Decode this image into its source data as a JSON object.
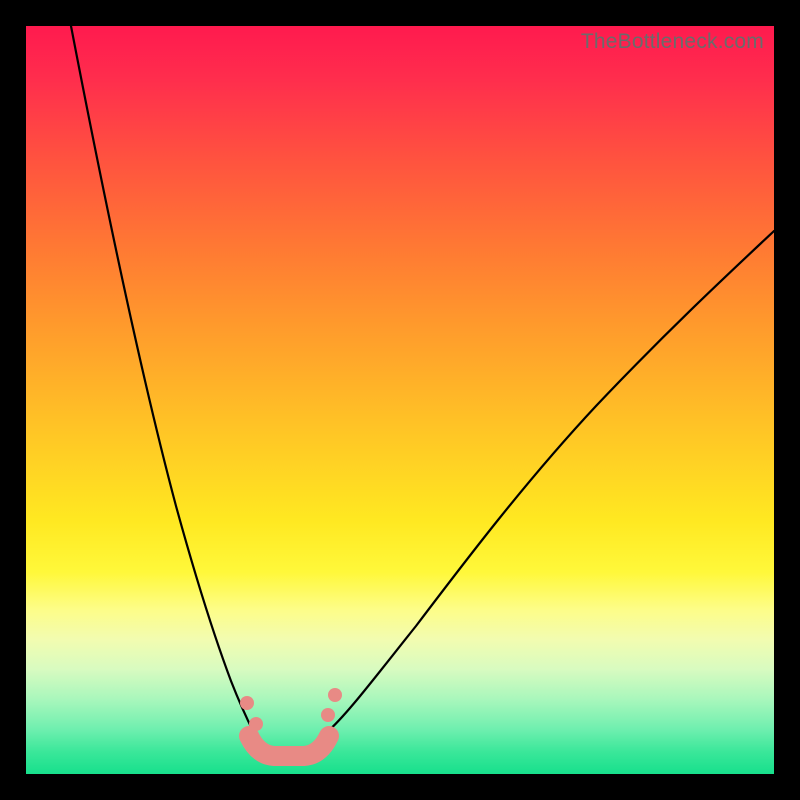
{
  "watermark": "TheBottleneck.com",
  "colors": {
    "bg_black": "#000000",
    "marker": "#e88a85",
    "line": "#000000",
    "gradient_top": "#ff1a4e",
    "gradient_bottom": "#17e08c"
  },
  "chart_data": {
    "type": "line",
    "title": "",
    "xlabel": "",
    "ylabel": "",
    "xlim": [
      0,
      100
    ],
    "ylim": [
      0,
      100
    ],
    "grid": false,
    "legend": false,
    "annotations": [
      "TheBottleneck.com"
    ],
    "note": "Axes are unlabeled; values are estimated from positions as percentages of the inner plot area (0,0 = top-left of gradient area, 100,100 = bottom-right).",
    "series": [
      {
        "name": "left-curve",
        "description": "Steep curve descending from upper-left toward the valley",
        "x": [
          6,
          10,
          15,
          20,
          23,
          25,
          27,
          29,
          30
        ],
        "y": [
          0,
          24,
          50,
          70,
          80,
          86,
          90,
          93,
          95
        ]
      },
      {
        "name": "right-curve",
        "description": "Curve rising from the valley toward the upper-right",
        "x": [
          40,
          45,
          52,
          60,
          70,
          82,
          92,
          100
        ],
        "y": [
          95,
          91,
          85,
          76,
          63,
          48,
          36,
          27
        ]
      },
      {
        "name": "valley-marker",
        "description": "Salmon-colored flat-bottom marker at the trough of the V",
        "x": [
          30,
          32,
          34,
          36,
          38,
          40
        ],
        "y": [
          95,
          97,
          97.5,
          97.5,
          97,
          95
        ]
      }
    ],
    "marker_dots": [
      {
        "x": 29.5,
        "y": 90.5
      },
      {
        "x": 30.7,
        "y": 93.3
      },
      {
        "x": 40.4,
        "y": 92.1
      },
      {
        "x": 41.3,
        "y": 89.4
      }
    ]
  }
}
